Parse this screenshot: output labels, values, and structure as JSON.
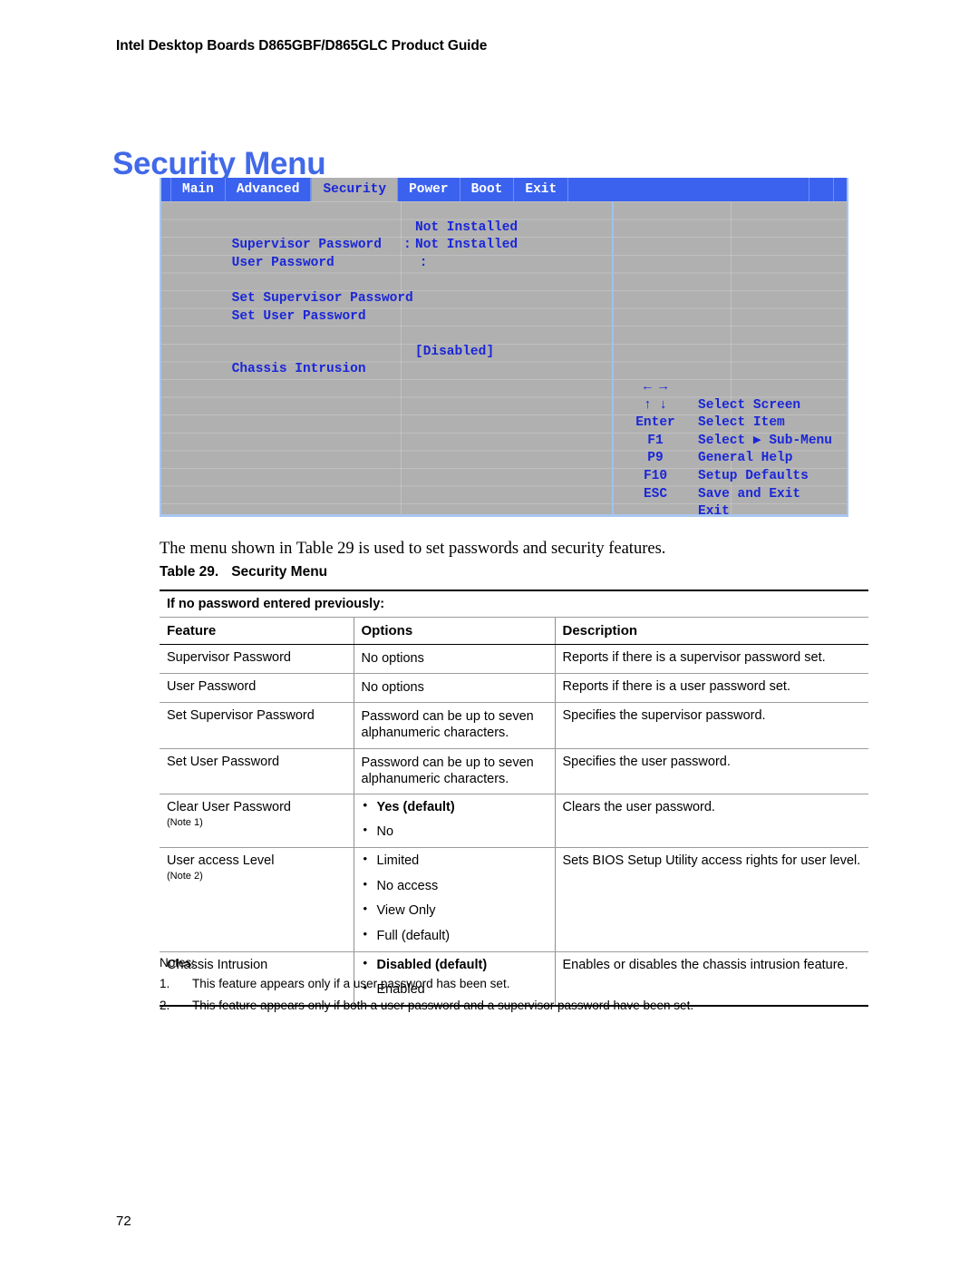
{
  "document": {
    "running_header": "Intel Desktop Boards D865GBF/D865GLC Product Guide",
    "page_title": "Security Menu",
    "page_number": "72",
    "body_paragraph": "The menu shown in Table 29 is used to set passwords and security features."
  },
  "bios_screen": {
    "tabs": [
      {
        "label": "Main",
        "active": false
      },
      {
        "label": "Advanced",
        "active": false
      },
      {
        "label": "Security",
        "active": true
      },
      {
        "label": "Power",
        "active": false
      },
      {
        "label": "Boot",
        "active": false
      },
      {
        "label": "Exit",
        "active": false
      }
    ],
    "items": [
      {
        "label": "Supervisor Password",
        "separator": ":",
        "value": "Not Installed"
      },
      {
        "label": "User Password",
        "separator": ":",
        "value": "Not Installed"
      },
      {
        "label": "Set Supervisor Password",
        "separator": "",
        "value": ""
      },
      {
        "label": "Set User Password",
        "separator": "",
        "value": ""
      },
      {
        "label": "Chassis Intrusion",
        "separator": "",
        "value": "[Disabled]"
      }
    ],
    "legend": [
      {
        "key": "← →",
        "action": "Select Screen"
      },
      {
        "key": "↑ ↓",
        "action": "Select Item"
      },
      {
        "key": "Enter",
        "action": "Select ▶ Sub-Menu"
      },
      {
        "key": "F1",
        "action": "General Help"
      },
      {
        "key": "P9",
        "action": "Setup Defaults"
      },
      {
        "key": "F10",
        "action": "Save and Exit"
      },
      {
        "key": "ESC",
        "action": "Exit"
      }
    ],
    "colors": {
      "tab_bar": "#3b62ee",
      "panel": "#b0b0b0",
      "text": "#1a26d8",
      "border": "#a9c6f0"
    }
  },
  "table": {
    "caption_number": "Table 29.",
    "caption_title": "Security Menu",
    "band_label": "If no password entered previously:",
    "headers": [
      "Feature",
      "Options",
      "Description"
    ],
    "rows": [
      {
        "feature": "Supervisor Password",
        "note": "",
        "options_plain": "No options",
        "options": [],
        "description": "Reports if there is a supervisor password set."
      },
      {
        "feature": "User Password",
        "note": "",
        "options_plain": "No options",
        "options": [],
        "description": "Reports if there is a user password set."
      },
      {
        "feature": "Set Supervisor Password",
        "note": "",
        "options_plain": "Password can be up to seven alphanumeric characters.",
        "options": [],
        "description": "Specifies the supervisor password."
      },
      {
        "feature": "Set User Password",
        "note": "",
        "options_plain": "Password can be up to seven alphanumeric characters.",
        "options": [],
        "description": "Specifies the user password."
      },
      {
        "feature": "Clear User Password",
        "note": "(Note 1)",
        "options_plain": "",
        "options": [
          {
            "text": "Yes (default)",
            "bold": true
          },
          {
            "text": "No",
            "bold": false
          }
        ],
        "description": "Clears the user password."
      },
      {
        "feature": "User access Level",
        "note": "(Note 2)",
        "options_plain": "",
        "options": [
          {
            "text": "Limited",
            "bold": false
          },
          {
            "text": "No access",
            "bold": false
          },
          {
            "text": "View Only",
            "bold": false
          },
          {
            "text": "Full (default)",
            "bold": false
          }
        ],
        "description": "Sets BIOS Setup Utility access rights for user level."
      },
      {
        "feature": "Chassis Intrusion",
        "note": "",
        "options_plain": "",
        "options": [
          {
            "text": "Disabled (default)",
            "bold": true
          },
          {
            "text": "Enabled",
            "bold": false
          }
        ],
        "description": "Enables or disables the chassis intrusion feature."
      }
    ]
  },
  "notes": {
    "title": "Notes:",
    "items": [
      {
        "number": "1.",
        "text": "This feature appears only if a user password has been set."
      },
      {
        "number": "2.",
        "text": "This feature appears only if both a user password and a supervisor password have been set."
      }
    ]
  }
}
